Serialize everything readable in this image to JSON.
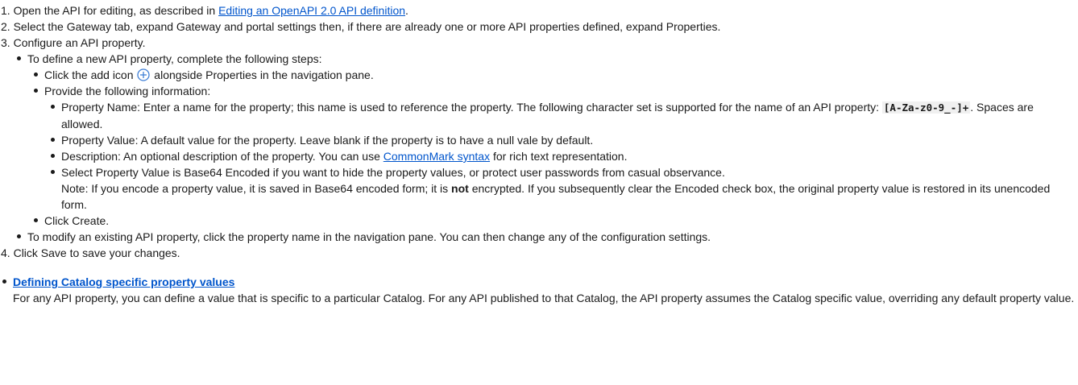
{
  "steps": {
    "s1": {
      "num": "1.",
      "pre": "Open the API for editing, as described in",
      "link": "Editing an OpenAPI 2.0 API definition",
      "post": "."
    },
    "s2": {
      "num": "2.",
      "text": "Select the Gateway tab, expand Gateway and portal settings then, if there are already one or more API properties defined, expand Properties."
    },
    "s3": {
      "num": "3.",
      "text": "Configure an API property."
    },
    "s4": {
      "num": "4.",
      "text": "Click Save to save your changes."
    }
  },
  "define_new": {
    "text": "To define a new API property, complete the following steps:",
    "click_add": {
      "pre": "Click the add icon",
      "post": "alongside Properties in the navigation pane."
    },
    "provide": "Provide the following information:",
    "property_name": {
      "pre": "Property Name: Enter a name for the property; this name is used to reference the property. The following character set is supported for the name of an API property:",
      "code": "[A-Za-z0-9_-]+",
      "post": ". Spaces are allowed."
    },
    "property_value": "Property Value: A default value for the property. Leave blank if the property is to have a null vale by default.",
    "description": {
      "pre": "Description: An optional description of the property. You can use",
      "link": "CommonMark syntax",
      "post": "for rich text representation."
    },
    "encoded": {
      "line1": "Select Property Value is Base64 Encoded if you want to hide the property values, or protect user passwords from casual observance.",
      "note_pre": "Note: If you encode a property value, it is saved in Base64 encoded form; it is",
      "note_bold": "not",
      "note_post": "encrypted. If you subsequently clear the Encoded check box, the original property value is restored in its unencoded form."
    },
    "click_create": "Click Create."
  },
  "modify_existing": "To modify an existing API property, click the property name in the navigation pane. You can then change any of the configuration settings.",
  "related": {
    "link": "Defining Catalog specific property values",
    "desc": "For any API property, you can define a value that is specific to a particular Catalog. For any API published to that Catalog, the API property assumes the Catalog specific value, overriding any default property value."
  },
  "colors": {
    "link": "#0055cc",
    "icon": "#3f7fd6"
  },
  "icons": {
    "add": "add-circle-icon"
  }
}
